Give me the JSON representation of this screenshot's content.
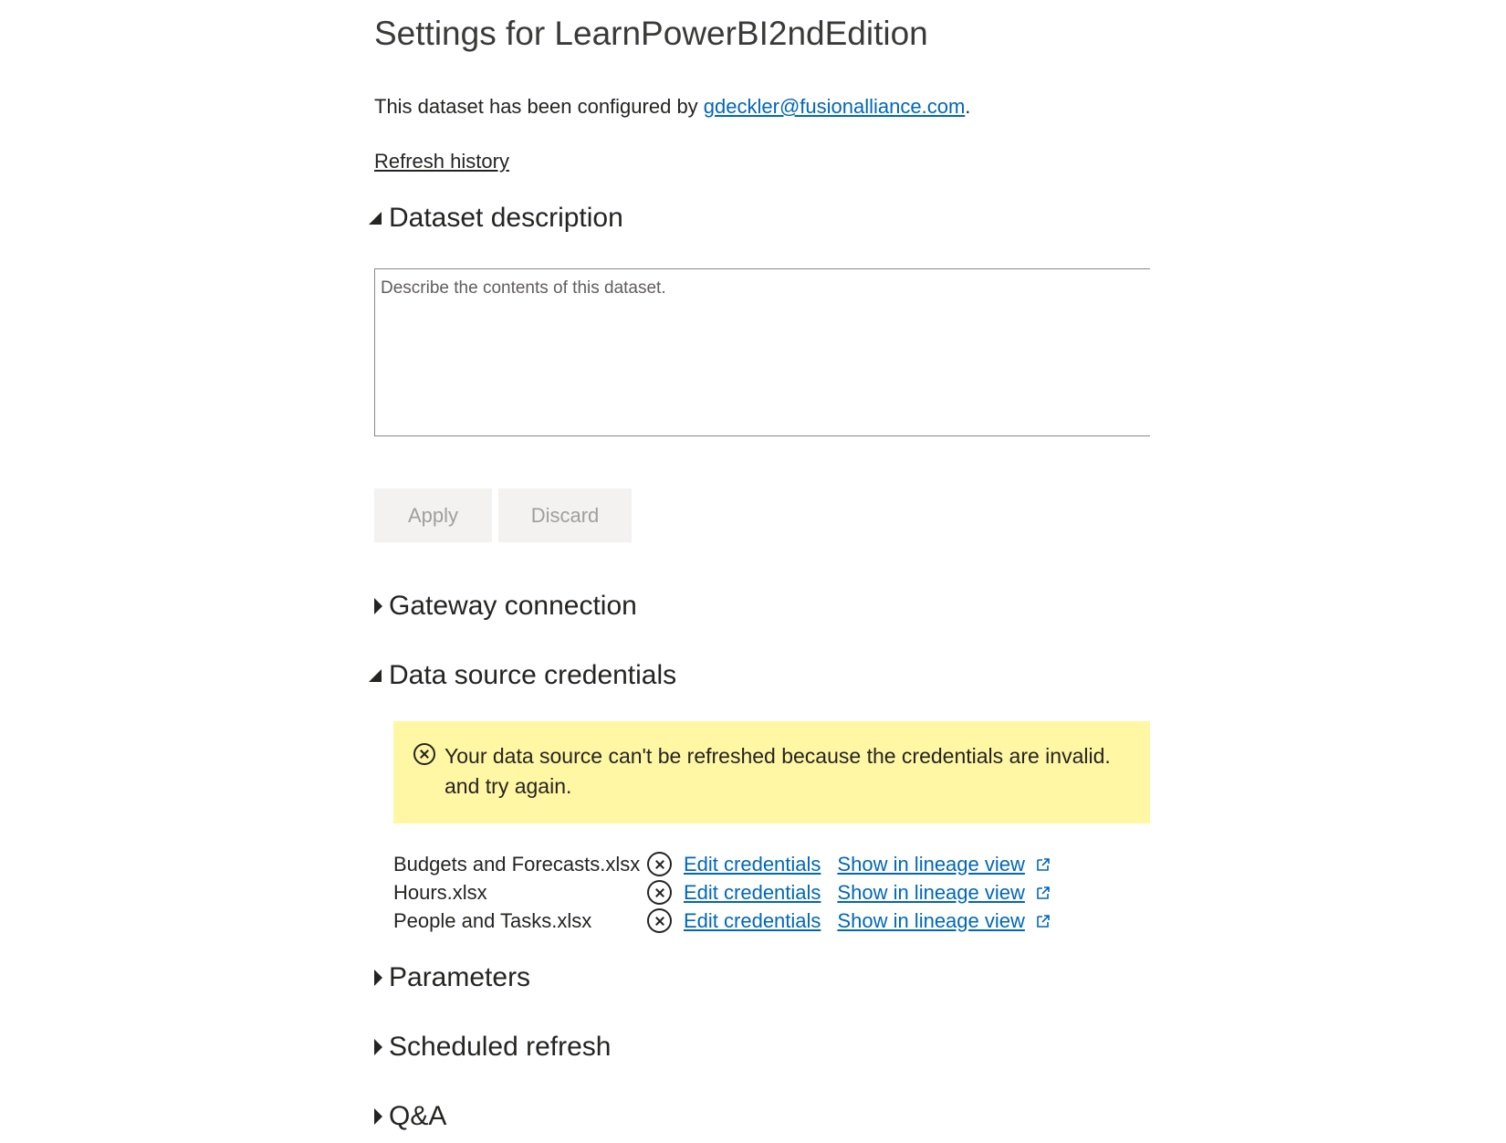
{
  "header": {
    "title": "Settings for LearnPowerBI2ndEdition",
    "configured_prefix": "This dataset has been configured by ",
    "configured_email": "gdeckler@fusionalliance.com",
    "configured_suffix": ".",
    "refresh_history": "Refresh history"
  },
  "sections": {
    "dataset_description": "Dataset description",
    "gateway_connection": "Gateway connection",
    "data_source_credentials": "Data source credentials",
    "parameters": "Parameters",
    "scheduled_refresh": "Scheduled refresh",
    "qa": "Q&A"
  },
  "description": {
    "placeholder": "Describe the contents of this dataset.",
    "value": ""
  },
  "buttons": {
    "apply": "Apply",
    "discard": "Discard"
  },
  "warning": {
    "line1": "Your data source can't be refreshed because the credentials are invalid.",
    "line2": "and try again.",
    "background_color": "#fff7a3"
  },
  "credentials": [
    {
      "name": "Budgets and Forecasts.xlsx",
      "edit_label": "Edit credentials",
      "lineage_label": "Show in lineage view"
    },
    {
      "name": "Hours.xlsx",
      "edit_label": "Edit credentials",
      "lineage_label": "Show in lineage view"
    },
    {
      "name": "People and Tasks.xlsx",
      "edit_label": "Edit credentials",
      "lineage_label": "Show in lineage view"
    }
  ],
  "colors": {
    "link": "#0067b8",
    "text": "#252423",
    "button_bg": "#f3f2f1",
    "button_text": "#a19f9d"
  },
  "icons": {
    "expanded_caret": "caret-expanded-icon",
    "collapsed_caret": "caret-right-icon",
    "error": "error-circle-x-icon",
    "external_link": "external-link-icon"
  }
}
